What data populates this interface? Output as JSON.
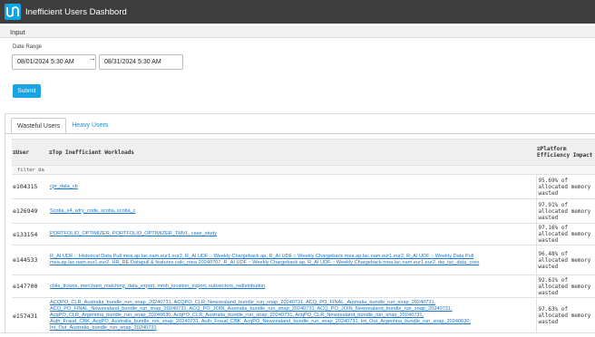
{
  "header": {
    "title": "Inefficient Users Dashbord",
    "logo_icon": "un-logo-icon"
  },
  "input_section": {
    "label": "Input"
  },
  "date_range": {
    "label": "Date Range",
    "start": "08/01/2024 5:30 AM",
    "end": "08/31/2024 5:30 AM",
    "separator": "→"
  },
  "submit_label": "Submit",
  "tabs": [
    {
      "label": "Wasteful Users",
      "active": true
    },
    {
      "label": "Heavy Users",
      "active": false
    }
  ],
  "table": {
    "columns": [
      "≡User",
      "≡Top Inefficient Workloads",
      "≡Platform Efficiency Impact"
    ],
    "filter_placeholder": "filter da",
    "rows": [
      {
        "user": "e104315",
        "workloads": "cpr_data_cb",
        "impact": "95.69% of allocated memory wasted"
      },
      {
        "user": "e126949",
        "workloads": "Scotia_s4, wfry_code, scotia, scotia_c",
        "impact": "97.91% of allocated memory wasted"
      },
      {
        "user": "e133154",
        "workloads": "PORTFOLIO_OPTIMIZER, PORTFOLIO_OPTIMIZER_TMVL, case_study",
        "impact": "97.16% of allocated memory wasted"
      },
      {
        "user": "e144533",
        "workloads": "R_AI UDF :: Historical Data Pull mea.ap.lac.nam.eur1.eur2, R_AI UDF :: Weekly Chargeback ap, R_AI UDF :: Weekly Chargeback mea.ap.lac.nam.eur1.eur2, R_AI UDF :: Weekly Data Pull mea.ap.lac.nam.eur1.eur2, HR_RE Datapull & features calc_mea 20240707, R_AI UDF :: Weekly Chargeback ap, R_AI UDF :: Weekly Chargeback mea.lac.nam.eur1.eur2, dw_tsc_data_creo",
        "impact": "96.48% of allocated memory wasted"
      },
      {
        "user": "e147700",
        "workloads": "chile_tickets, merchant_matching_data_export, mmh_location_export, subsectors_redistribution",
        "impact": "92.61% of allocated memory wasted"
      },
      {
        "user": "e157431",
        "workloads": "ACQPO_CLR_Australia_bundle_run_snap_20240731, ACQPO_CLR_Newzealand_bundle_run_snap_20240731, ACQ_PO_FINAL_Australia_bundle_run_snap_20240731, ACQ_PO_FINAL_Newzealand_bundle_run_snap_20240731, ACQ_PO_JOIN_Australia_bundle_run_snap_20240731, ACQ_PO_JOIN_Newzealand_bundle_run_snap_20240731, AcqPO_CLR_Argentina_bundle_run_snap_20240630, AcqPO_CLR_Australia_bundle_run_snap_20240731, AcqPO_CLR_Newzealand_bundle_run_snap_20240731, Auth_Fraud_CBK_AcqPO_Australia_bundle_run_snap_20240731, Auth_Fraud_CBK_AcqPO_Newzealand_bundle_run_snap_20240731, Int_Out_Argentina_bundle_run_snap_20240630, Int_Out_Australia_bundle_run_snap_20240731",
        "impact": "97.63% of allocated memory wasted"
      }
    ]
  },
  "colors": {
    "topbar": "#3d3d3d",
    "accent": "#1aa3e4",
    "link": "#1a75c9"
  }
}
